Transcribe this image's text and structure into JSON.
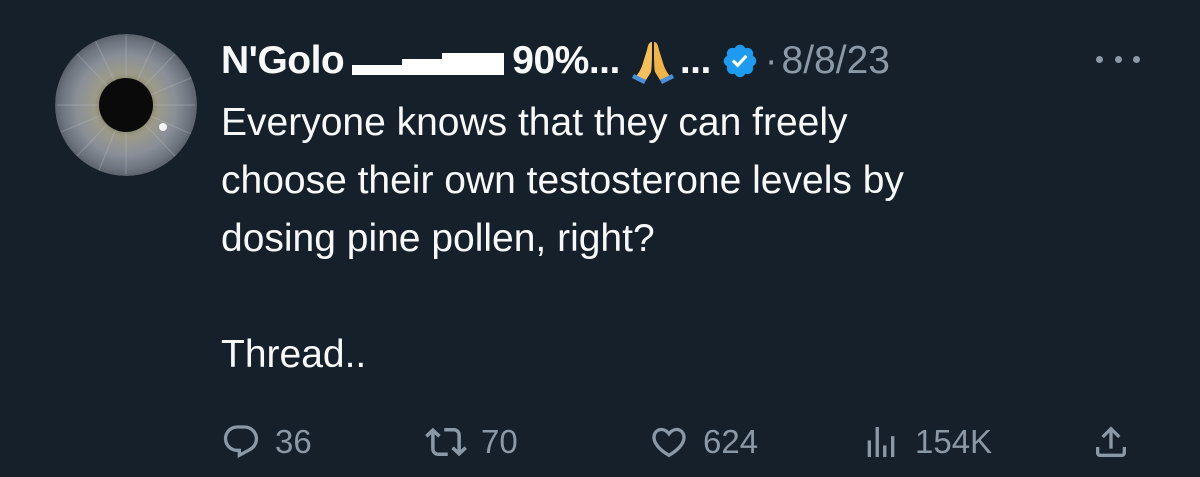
{
  "tweet": {
    "author": {
      "display_name": "N'Golo",
      "name_suffix": "90%...",
      "trailing_ellipsis": "...",
      "emoji": "folded-hands",
      "verified": true,
      "verified_color": "#1d9bf0",
      "separator": "·",
      "timestamp": "8/8/23"
    },
    "text": {
      "line1": "Everyone knows that they can freely",
      "line2": "choose their own testosterone levels by",
      "line3": "dosing pine pollen, right?",
      "line4": "Thread.."
    },
    "actions": {
      "replies": "36",
      "retweets": "70",
      "likes": "624",
      "views": "154K"
    }
  },
  "colors": {
    "background": "#15202b",
    "primary_text": "#f7f9f9",
    "secondary_text": "#8b98a5"
  }
}
